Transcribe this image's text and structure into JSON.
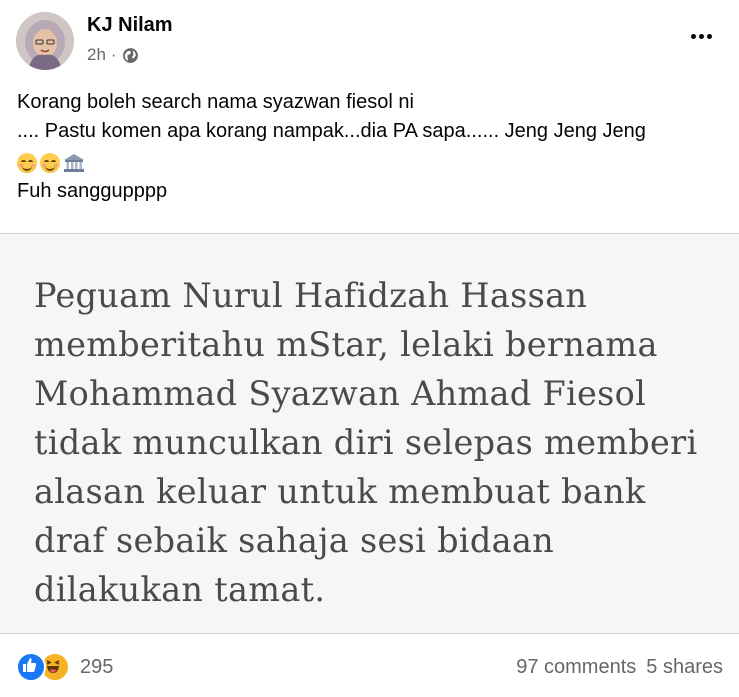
{
  "post": {
    "author": "KJ Nilam",
    "time": "2h",
    "separator": "·",
    "audience_icon": "globe-icon",
    "more_icon": "more-options-icon",
    "text_lines": [
      "Korang boleh search nama syazwan fiesol ni",
      ".... Pastu komen apa korang nampak...dia PA sapa......  Jeng Jeng Jeng"
    ],
    "emojis": [
      "smiling-face-icon",
      "smiling-face-icon",
      "bank-icon"
    ],
    "text_last": "Fuh sanggupppp"
  },
  "image": {
    "lines": [
      "Peguam Nurul Hafidzah Hassan",
      "memberitahu mStar, lelaki bernama",
      "Mohammad Syazwan Ahmad Fiesol",
      "tidak munculkan diri selepas memberi",
      "alasan keluar untuk membuat bank",
      "draf sebaik sahaja sesi bidaan",
      "dilakukan tamat."
    ]
  },
  "footer": {
    "reaction_icons": [
      "like-icon",
      "haha-icon"
    ],
    "reaction_count": "295",
    "comments": "97 comments",
    "shares": "5 shares"
  },
  "colors": {
    "like_blue": "#1877f2",
    "haha_yellow": "#f7b125",
    "secondary_text": "#65676b",
    "image_text": "#4a4a4a"
  }
}
